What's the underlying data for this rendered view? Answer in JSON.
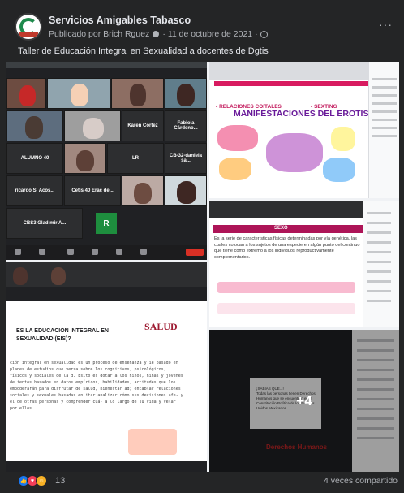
{
  "post": {
    "page_name": "Servicios Amigables Tabasco",
    "byline": "Publicado por Brich Rguez",
    "date": "11 de octubre de 2021",
    "separator": "·",
    "more": "···",
    "caption": "Taller de Educación Integral en Sexualidad a docentes de Dgtis"
  },
  "photos": {
    "zoom_gallery": {
      "participants": [
        "Karen Cortez",
        "Fabiola Cárdeno...",
        "ALUMNO 40",
        "LR",
        "CB-32-daniela sa...",
        "ricardo S. Acos...",
        "Cetis 40 Erac de...",
        "CBS3 Gladimir A...",
        "R"
      ]
    },
    "slide_erotismo": {
      "title": "MANIFESTACIONES DEL EROTISMO",
      "item_1": "• RELACIONES COITALES",
      "item_2": "• SEXTING"
    },
    "slide_sexo": {
      "title": "SEXO",
      "text": "Es la serie de características físicas determinadas por vía genética, las cuales colocan a los sujetos de una especie en algún punto del continuo que tiene como extremo a los individuos reproductivamente complementarios."
    },
    "slide_eis": {
      "title": "ES LA EDUCACIÓN INTEGRAL EN SEXUALIDAD (EIS)?",
      "logo": "SALUD",
      "body": "ción integral en sexualidad es un proceso de enseñanza y ie basado en planes de estudios que versa sobre los cognitivos, psicológicos, físicos y sociales de la d. Esito es dotar a los niños, niñas y jóvenes de ientos basados en datos empíricos, habilidades, actitudes que los empoderarán para disfrutar de salud, bienestar ad; entablar relaciones sociales y sexuales basadas en itar analizar cómo sus decisiones afe- y el de otras personas y comprender cuá- a lo largo de su vida y velar por ellos."
    },
    "slide_derechos": {
      "card_title": "¡SABÍAS QUE...!",
      "card_text": "Todas las personas tienen Derechos Humanos que se encuentran en la Constitución Política de los Estados Unidos Mexicanos.",
      "brand": "Derechos Humanos"
    },
    "more_overlay": "+4"
  },
  "footer": {
    "reaction_count": "13",
    "shares": "4 veces compartido"
  },
  "colors": {
    "bg": "#242526",
    "text": "#e4e6eb",
    "muted": "#b0b3b8",
    "like": "#1877f2",
    "love": "#f33e58",
    "care": "#f7b125"
  }
}
